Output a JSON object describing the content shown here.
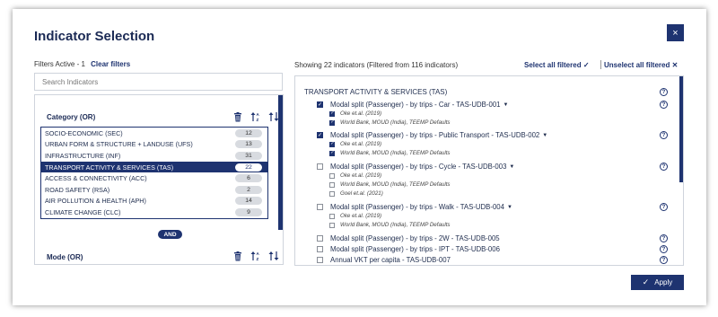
{
  "dialog": {
    "title": "Indicator Selection",
    "close_label": "×"
  },
  "filters": {
    "active_label": "Filters Active - 1",
    "clear_label": "Clear filters"
  },
  "search": {
    "placeholder": "Search Indicators"
  },
  "category_group": {
    "title": "Category (OR)",
    "items": [
      {
        "label": "SOCIO-ECONOMIC (SEC)",
        "count": "12"
      },
      {
        "label": "URBAN FORM & STRUCTURE + LANDUSE (UFS)",
        "count": "13"
      },
      {
        "label": "INFRASTRUCTURE (INF)",
        "count": "31"
      },
      {
        "label": "TRANSPORT ACTIVITY & SERVICES (TAS)",
        "count": "22",
        "selected": true
      },
      {
        "label": "ACCESS & CONNECTIVITY (ACC)",
        "count": "6"
      },
      {
        "label": "ROAD SAFETY (RSA)",
        "count": "2"
      },
      {
        "label": "AIR POLLUTION & HEALTH (APH)",
        "count": "14"
      },
      {
        "label": "CLIMATE CHANGE (CLC)",
        "count": "9"
      }
    ]
  },
  "and_label": "AND",
  "mode_group": {
    "title": "Mode (OR)"
  },
  "results": {
    "showing": "Showing 22 indicators (Filtered from 116 indicators)",
    "select_all": "Select all filtered",
    "unselect_all": "Unselect all filtered",
    "section_title": "TRANSPORT ACTIVITY & SERVICES (TAS)",
    "indicators": [
      {
        "label": "Modal split (Passenger) - by trips - Car - TAS-UDB-001",
        "checked": true,
        "expanded": true,
        "sources": [
          {
            "label": "Oke et.al. (2019)",
            "checked": true
          },
          {
            "label": "World Bank, MOUD (India), TEEMP Defaults",
            "checked": true
          }
        ]
      },
      {
        "label": "Modal split (Passenger) - by trips - Public Transport - TAS-UDB-002",
        "checked": true,
        "expanded": true,
        "sources": [
          {
            "label": "Oke et.al. (2019)",
            "checked": true
          },
          {
            "label": "World Bank, MOUD (India), TEEMP Defaults",
            "checked": true
          }
        ]
      },
      {
        "label": "Modal split (Passenger) - by trips - Cycle - TAS-UDB-003",
        "checked": false,
        "expanded": true,
        "sources": [
          {
            "label": "Oke et.al. (2019)",
            "checked": false
          },
          {
            "label": "World Bank, MOUD (India), TEEMP Defaults",
            "checked": false
          },
          {
            "label": "Goel et.al. (2021)",
            "checked": false
          }
        ]
      },
      {
        "label": "Modal split (Passenger) - by trips - Walk - TAS-UDB-004",
        "checked": false,
        "expanded": true,
        "sources": [
          {
            "label": "Oke et.al. (2019)",
            "checked": false
          },
          {
            "label": "World Bank, MOUD (India), TEEMP Defaults",
            "checked": false
          }
        ]
      },
      {
        "label": "Modal split (Passenger) - by trips - 2W - TAS-UDB-005",
        "checked": false,
        "expanded": false,
        "sources": []
      },
      {
        "label": "Modal split (Passenger) - by trips - IPT - TAS-UDB-006",
        "checked": false,
        "expanded": false,
        "sources": []
      },
      {
        "label": "Annual VKT per capita - TAS-UDB-007",
        "checked": false,
        "expanded": false,
        "sources": []
      }
    ]
  },
  "apply_label": "Apply",
  "colors": {
    "accent": "#1e3370",
    "count_badge": "#d8dbe0"
  }
}
